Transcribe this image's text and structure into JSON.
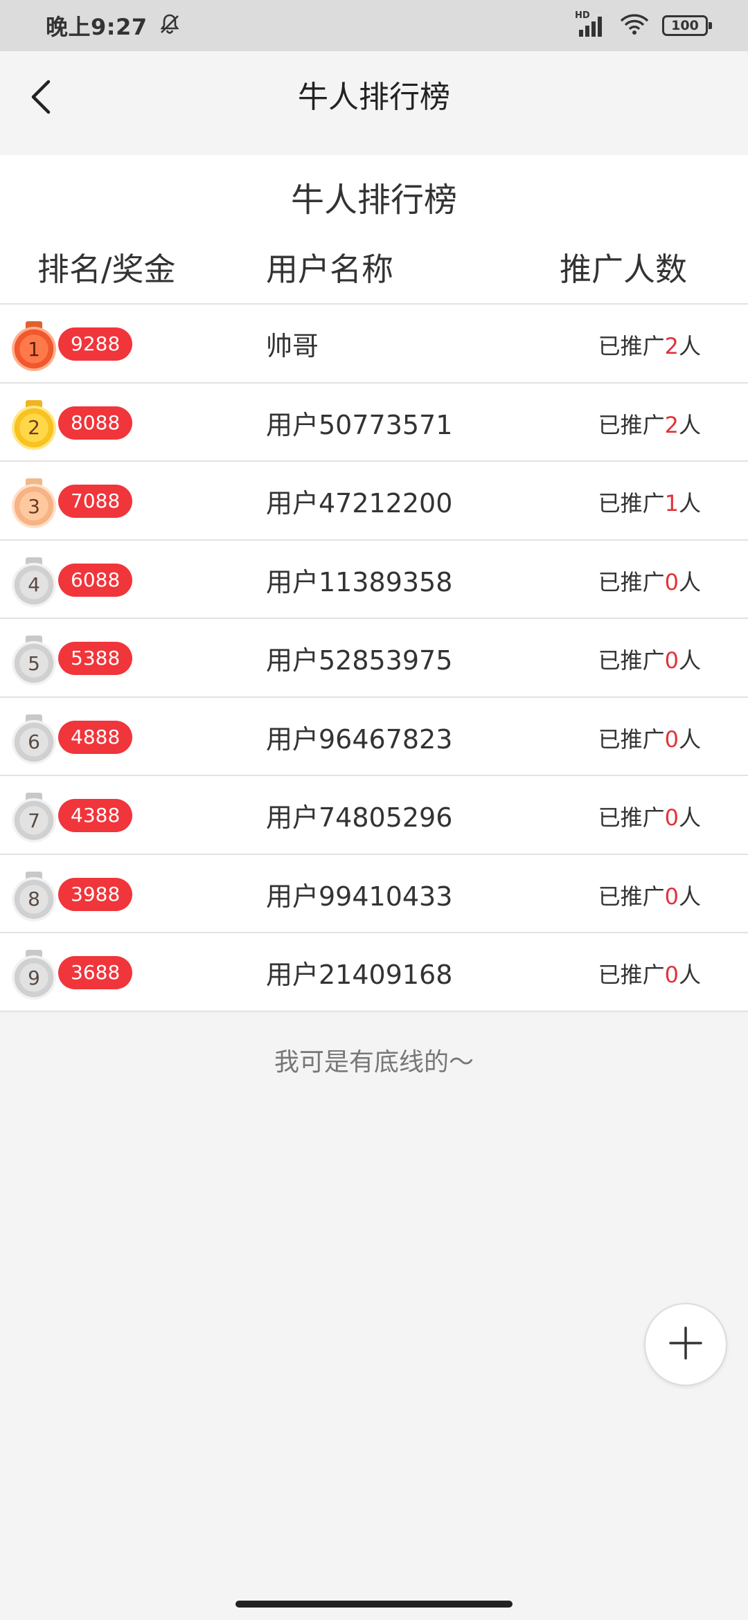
{
  "status_bar": {
    "time": "晚上9:27",
    "battery": "100",
    "network": "HD"
  },
  "nav": {
    "title": "牛人排行榜"
  },
  "board": {
    "title": "牛人排行榜",
    "headers": {
      "rank_prize": "排名/奖金",
      "username": "用户名称",
      "promoted": "推广人数"
    },
    "promo_prefix": "已推广",
    "promo_suffix": "人",
    "rows": [
      {
        "rank": "1",
        "prize": "9288",
        "name": "帅哥",
        "count": "2",
        "medal": "red"
      },
      {
        "rank": "2",
        "prize": "8088",
        "name": "用户50773571",
        "count": "2",
        "medal": "gold"
      },
      {
        "rank": "3",
        "prize": "7088",
        "name": "用户47212200",
        "count": "1",
        "medal": "bronze"
      },
      {
        "rank": "4",
        "prize": "6088",
        "name": "用户11389358",
        "count": "0",
        "medal": "silver"
      },
      {
        "rank": "5",
        "prize": "5388",
        "name": "用户52853975",
        "count": "0",
        "medal": "silver"
      },
      {
        "rank": "6",
        "prize": "4888",
        "name": "用户96467823",
        "count": "0",
        "medal": "silver"
      },
      {
        "rank": "7",
        "prize": "4388",
        "name": "用户74805296",
        "count": "0",
        "medal": "silver"
      },
      {
        "rank": "8",
        "prize": "3988",
        "name": "用户99410433",
        "count": "0",
        "medal": "silver"
      },
      {
        "rank": "9",
        "prize": "3688",
        "name": "用户21409168",
        "count": "0",
        "medal": "silver"
      }
    ]
  },
  "footer_note": "我可是有底线的～",
  "colors": {
    "accent_red": "#f0353b",
    "count_red": "#e0343a"
  },
  "icons": {
    "back": "chevron-left-icon",
    "fab": "plus-icon",
    "mute": "bell-off-icon",
    "signal": "signal-icon",
    "wifi": "wifi-icon",
    "battery": "battery-icon"
  }
}
